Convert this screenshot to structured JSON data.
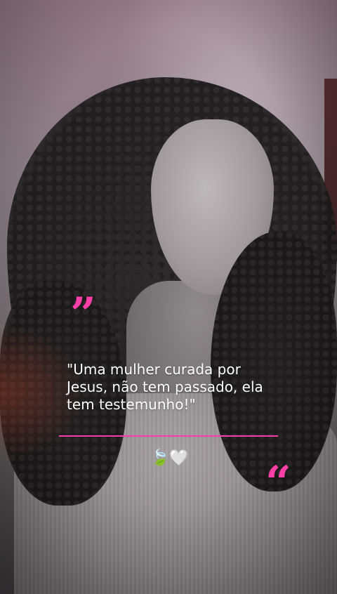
{
  "overlay": {
    "open_quote_mark": "”",
    "quote_text": "\"Uma mulher curada por Jesus, não tem passado, ela tem testemunho!\"",
    "emojis": "🍃🤍",
    "close_quote_mark": "“"
  },
  "colors": {
    "accent_pink": "#ff3fa8",
    "text_white": "#ffffff"
  },
  "photo": {
    "subject": "grayscale portrait of a woman with curly hair, eyes closed",
    "tint": "monochrome with warm red/magenta edges"
  }
}
